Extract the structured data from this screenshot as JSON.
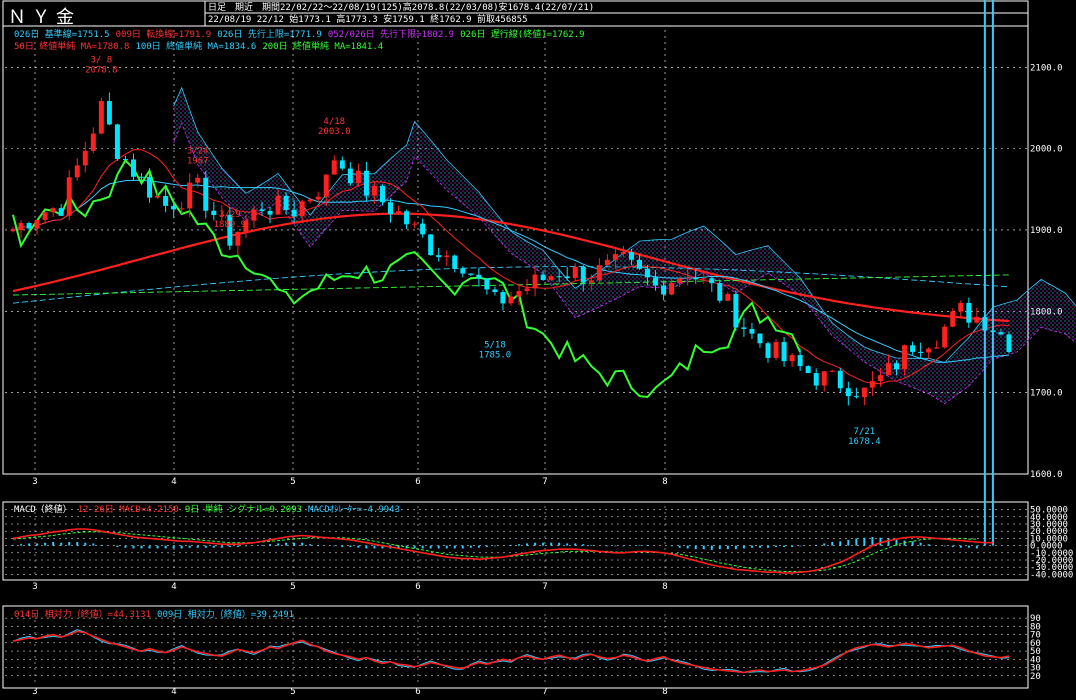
{
  "header": {
    "title": "ＮＹ金",
    "period_line": "日足　期近　期間22/02/22～22/08/19(125)高2078.8(22/03/08)安1678.4(22/07/21)",
    "ohlc_line": "22/08/19 22/12 始1773.1 高1773.3 安1759.1 終1762.9 前取456855"
  },
  "legend_row1": [
    {
      "text": "026日 基準線=1751.5",
      "color": "#33ccff"
    },
    {
      "text": "009日 転換線=1791.9",
      "color": "#ff3333"
    },
    {
      "text": "026日 先行上限=1771.9",
      "color": "#33ccff"
    },
    {
      "text": "052/026日 先行下限=1802.9",
      "color": "#cc33ff"
    },
    {
      "text": "026日 遅行線(終値)=1762.9",
      "color": "#33ff33"
    }
  ],
  "legend_row2": [
    {
      "text": "50日 終値単純 MA=1780.8",
      "color": "#ff3333"
    },
    {
      "text": "100日 終値単純 MA=1834.6",
      "color": "#33ccff"
    },
    {
      "text": "200日 終値単純 MA=1841.4",
      "color": "#33ff33"
    }
  ],
  "macd_legend": [
    {
      "text": "MACD（終値）",
      "color": "#ffffff"
    },
    {
      "text": "12-26日 MACD=4.2150",
      "color": "#ff3333"
    },
    {
      "text": "9日 単純 シグナル=9.2093",
      "color": "#33ff33"
    },
    {
      "text": "MACDｵｼﾚｰﾀｰ=-4.9943",
      "color": "#33ccff"
    }
  ],
  "rsi_legend": [
    {
      "text": "014日 相対力（終値）=44.3131",
      "color": "#ff3333"
    },
    {
      "text": "009日 相対力（終値）=39.2491",
      "color": "#33ccff"
    }
  ],
  "colors": {
    "up": "#ff2020",
    "down": "#00e5ff",
    "ma50": "#ff2020",
    "grid": "#ffffff"
  },
  "chart_data": [
    {
      "type": "candlestick",
      "ylim": [
        1600,
        2120
      ],
      "yticks": [
        "2100.0",
        "2000.0",
        "1900.0",
        "1800.0",
        "1700.0",
        "1600.0"
      ],
      "ytick_values": [
        2100,
        2000,
        1900,
        1800,
        1700,
        1600
      ],
      "xticks": [
        "3",
        "4",
        "5",
        "6",
        "7",
        "8"
      ],
      "annotations": [
        {
          "text": "3/ 8",
          "value": 2078.8,
          "day": 11
        },
        {
          "text": "2078.8",
          "value": 2078.8,
          "day": 11
        },
        {
          "text": "3/24",
          "value": 1967,
          "day": 23
        },
        {
          "text": "1967",
          "value": 1967,
          "day": 23
        },
        {
          "text": "3/29",
          "value": 1889,
          "day": 27
        },
        {
          "text": "1889.9",
          "value": 1889,
          "day": 27
        },
        {
          "text": "4/18",
          "value": 2003,
          "day": 40
        },
        {
          "text": "2003.0",
          "value": 2003,
          "day": 40
        },
        {
          "text": "5/18",
          "value": 1785,
          "day": 60
        },
        {
          "text": "1785.0",
          "value": 1785,
          "day": 60
        },
        {
          "text": "7/21",
          "value": 1678.4,
          "day": 106
        },
        {
          "text": "1678.4",
          "value": 1678.4,
          "day": 106
        }
      ]
    },
    {
      "type": "line",
      "name": "MACD",
      "ylim": [
        -45,
        55
      ],
      "yticks": [
        "50.0000",
        "40.0000",
        "30.0000",
        "20.0000",
        "10.0000",
        "0.0000",
        "-10.0000",
        "-20.0000",
        "-30.0000",
        "-40.0000"
      ],
      "ytick_values": [
        50,
        40,
        30,
        20,
        10,
        0,
        -10,
        -20,
        -30,
        -40
      ],
      "macd": [
        10,
        12,
        14,
        15,
        17,
        19,
        20,
        22,
        23,
        23,
        22,
        20,
        18,
        16,
        14,
        12,
        11,
        10,
        9,
        8,
        7,
        6,
        6,
        5,
        4,
        3,
        2,
        2,
        2,
        3,
        4,
        6,
        8,
        10,
        12,
        13,
        14,
        13,
        12,
        11,
        10,
        9,
        8,
        6,
        4,
        2,
        0,
        -2,
        -4,
        -6,
        -8,
        -10,
        -12,
        -14,
        -16,
        -17,
        -18,
        -18,
        -19,
        -18,
        -17,
        -16,
        -14,
        -12,
        -10,
        -8,
        -7,
        -6,
        -5,
        -5,
        -5,
        -6,
        -7,
        -8,
        -9,
        -10,
        -10,
        -9,
        -8,
        -8,
        -9,
        -10,
        -12,
        -15,
        -18,
        -21,
        -24,
        -27,
        -29,
        -31,
        -33,
        -34,
        -35,
        -36,
        -37,
        -37,
        -38,
        -38,
        -37,
        -36,
        -34,
        -31,
        -27,
        -23,
        -18,
        -12,
        -6,
        0,
        4,
        7,
        9,
        11,
        12,
        12,
        11,
        10,
        9,
        8,
        7,
        6,
        5,
        4,
        4
      ],
      "signal": [
        9,
        10,
        11,
        12,
        13,
        14,
        16,
        17,
        18,
        19,
        19,
        19,
        18,
        18,
        17,
        16,
        15,
        14,
        13,
        12,
        11,
        10,
        9,
        8,
        7,
        6,
        5,
        4,
        4,
        4,
        4,
        5,
        6,
        7,
        8,
        9,
        10,
        11,
        11,
        11,
        11,
        11,
        10,
        9,
        8,
        6,
        4,
        2,
        0,
        -2,
        -4,
        -6,
        -8,
        -10,
        -12,
        -13,
        -14,
        -15,
        -16,
        -16,
        -16,
        -16,
        -15,
        -14,
        -13,
        -12,
        -11,
        -10,
        -9,
        -8,
        -8,
        -8,
        -8,
        -8,
        -8,
        -9,
        -9,
        -9,
        -9,
        -9,
        -9,
        -10,
        -11,
        -12,
        -14,
        -16,
        -19,
        -21,
        -24,
        -26,
        -28,
        -30,
        -32,
        -33,
        -34,
        -35,
        -36,
        -36,
        -36,
        -36,
        -35,
        -34,
        -32,
        -29,
        -26,
        -22,
        -17,
        -12,
        -7,
        -3,
        1,
        4,
        6,
        8,
        9,
        10,
        10,
        10,
        10,
        9,
        9
      ]
    },
    {
      "type": "line",
      "name": "RSI",
      "ylim": [
        10,
        95
      ],
      "yticks": [
        "90",
        "80",
        "70",
        "60",
        "50",
        "40",
        "30",
        "20"
      ],
      "ytick_values": [
        90,
        80,
        70,
        60,
        50,
        40,
        30,
        20
      ],
      "rsi14": [
        62,
        64,
        66,
        65,
        68,
        70,
        67,
        70,
        74,
        72,
        68,
        64,
        60,
        58,
        55,
        52,
        50,
        53,
        50,
        48,
        51,
        55,
        52,
        49,
        47,
        45,
        44,
        48,
        52,
        50,
        48,
        51,
        55,
        53,
        57,
        60,
        63,
        58,
        55,
        50,
        47,
        45,
        43,
        40,
        42,
        38,
        35,
        37,
        34,
        33,
        31,
        33,
        36,
        34,
        32,
        30,
        29,
        33,
        36,
        34,
        37,
        40,
        38,
        42,
        44,
        41,
        40,
        43,
        45,
        42,
        40,
        44,
        46,
        43,
        41,
        42,
        45,
        43,
        40,
        38,
        41,
        43,
        39,
        36,
        34,
        32,
        30,
        28,
        27,
        26,
        25,
        24,
        26,
        27,
        25,
        26,
        27,
        25,
        26,
        28,
        30,
        33,
        38,
        44,
        50,
        54,
        56,
        58,
        57,
        55,
        57,
        59,
        58,
        56,
        54,
        55,
        56,
        57,
        54,
        50,
        47,
        44,
        43,
        42,
        44
      ]
    }
  ]
}
